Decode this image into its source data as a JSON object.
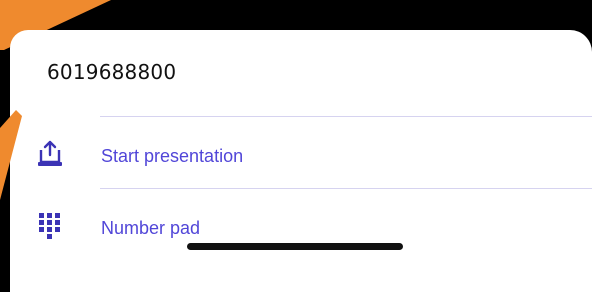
{
  "sheet": {
    "meeting_id": "6019688800",
    "rows": [
      {
        "label": "Start presentation",
        "icon": "share-screen-icon"
      },
      {
        "label": "Number pad",
        "icon": "keypad-icon"
      }
    ]
  },
  "colors": {
    "accent": "#5146d8",
    "annotation": "#ef8a2e",
    "background": "#000000",
    "sheet": "#ffffff",
    "divider": "#d6d3f0"
  }
}
